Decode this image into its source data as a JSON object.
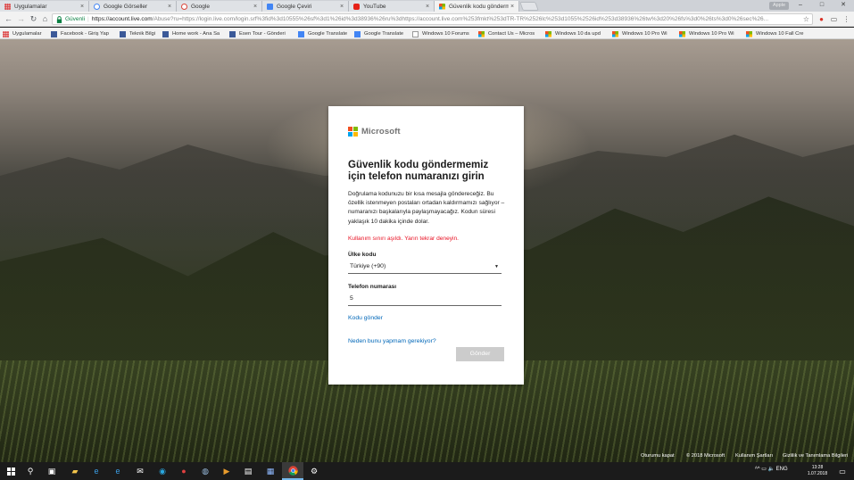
{
  "browser": {
    "tabs": [
      {
        "label": "Uygulamalar",
        "icon": "apps-grid-icon",
        "active": false
      },
      {
        "label": "Google Görseller",
        "icon": "google-g-icon",
        "active": false
      },
      {
        "label": "Google",
        "icon": "google-g-icon",
        "active": false
      },
      {
        "label": "Google Çeviri",
        "icon": "google-translate-icon",
        "active": false
      },
      {
        "label": "YouTube",
        "icon": "youtube-icon",
        "active": false
      },
      {
        "label": "Güvenlik kodu göndermem",
        "icon": "microsoft-icon",
        "active": true
      }
    ],
    "tab_close_glyph": "×",
    "profile_label": "Apple",
    "window_controls": {
      "minimize": "–",
      "maximize": "□",
      "close": "✕"
    },
    "address": {
      "secure_label": "Güvenli",
      "url_host": "https://account.live.com",
      "url_rest": "/Abuse?ru=https://login.live.com/login.srf%3fid%3d10555%26sf%3d1%26id%3d38936%26ru%3dhttps://account.live.com%253fmkt%253dTR-TR%2526lc%253d1055%2526id%253d38936%26tw%3d20%26fs%3d0%26ts%3d0%26sec%26..."
    },
    "bookmarks": [
      {
        "label": "Uygulamalar",
        "icon": "apps-grid-icon"
      },
      {
        "label": "Facebook - Giriş Yap",
        "icon": "facebook-icon"
      },
      {
        "label": "Teknik Bilgi",
        "icon": "facebook-icon"
      },
      {
        "label": "Home work - Ana Sa",
        "icon": "facebook-icon"
      },
      {
        "label": "Esen Tour - Gönderi",
        "icon": "facebook-icon"
      },
      {
        "label": "Google Translate",
        "icon": "google-translate-icon"
      },
      {
        "label": "Google Translate",
        "icon": "google-translate-icon"
      },
      {
        "label": "Windows 10 Forums",
        "icon": "page-icon"
      },
      {
        "label": "Contact Us – Micros",
        "icon": "microsoft-icon"
      },
      {
        "label": "Windows 10 da upd",
        "icon": "microsoft-icon"
      },
      {
        "label": "Windows 10 Pro Wi",
        "icon": "microsoft-icon"
      },
      {
        "label": "Windows 10 Pro Wi",
        "icon": "microsoft-icon"
      },
      {
        "label": "Windows 10 Fall Cre",
        "icon": "microsoft-icon"
      }
    ]
  },
  "dialog": {
    "brand": "Microsoft",
    "title": "Güvenlik kodu göndermemiz için telefon numaranızı girin",
    "description": "Doğrulama kodunuzu bir kısa mesajla göndereceğiz. Bu özellik istenmeyen postaları ortadan kaldırmamızı sağlıyor – numaranızı başkalarıyla paylaşmayacağız. Kodun süresi yaklaşık 10 dakika içinde dolar.",
    "error": "Kullanım sınırı aşıldı. Yarın tekrar deneyin.",
    "country_label": "Ülke kodu",
    "country_value": "Türkiye (+90)",
    "phone_label": "Telefon numarası",
    "phone_value": "5",
    "send_code_link": "Kodu gönder",
    "why_link": "Neden bunu yapmam gerekiyor?",
    "submit_label": "Gönder"
  },
  "footer": {
    "sign_out": "Oturumu kapat",
    "copyright": "© 2018 Microsoft",
    "terms": "Kullanım Şartları",
    "privacy": "Gizlilik ve Tanımlama Bilgileri"
  },
  "taskbar": {
    "apps": [
      "windows-start-icon",
      "search-icon",
      "task-view-icon",
      "file-explorer-icon",
      "edge-icon",
      "edge-icon",
      "mail-icon",
      "skype-icon",
      "opera-icon",
      "app-icon",
      "media-player-icon",
      "store-icon",
      "photos-icon",
      "chrome-icon",
      "settings-icon"
    ],
    "time": "13:28",
    "date": "1.07.2018",
    "tray_glyphs": "ᴬ^ ▭ 🔈 ENG"
  },
  "colors": {
    "ms_red": "#f25022",
    "ms_green": "#7fba00",
    "ms_blue": "#00a4ef",
    "ms_yellow": "#ffb900",
    "link": "#0067b8",
    "error": "#e81123"
  }
}
